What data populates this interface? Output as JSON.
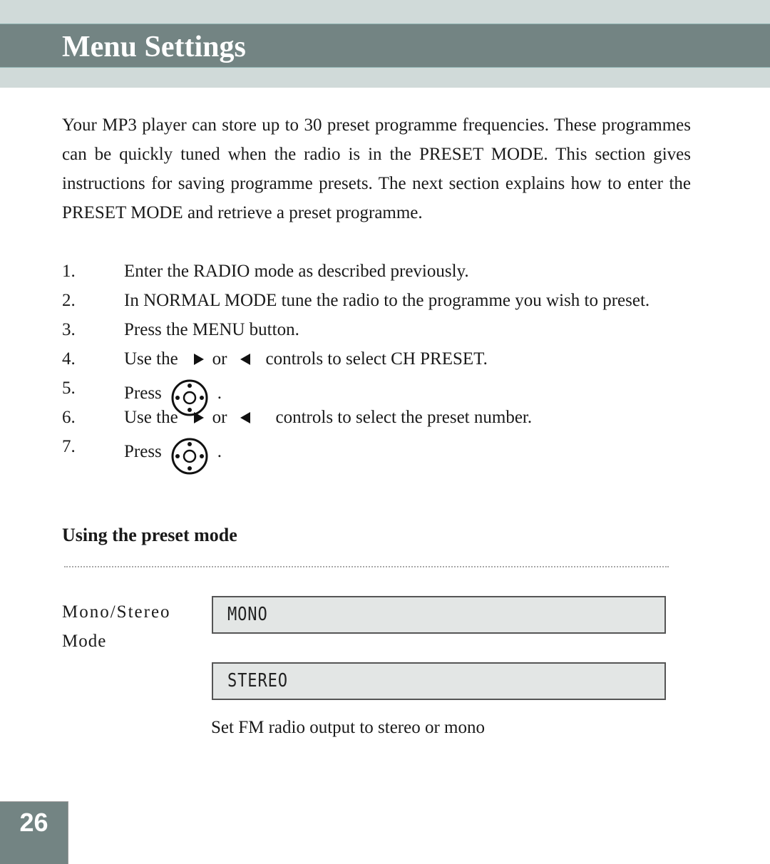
{
  "header": {
    "title": "Menu Settings"
  },
  "intro": "Your MP3 player can store up to 30 preset programme frequencies. These programmes can be quickly tuned when the radio is in the PRESET MODE. This section gives instructions for saving programme presets. The next section explains how to enter the PRESET MODE and retrieve a preset programme.",
  "steps": [
    {
      "num": "1.",
      "text": "Enter the RADIO mode as described previously."
    },
    {
      "num": "2.",
      "text": "In NORMAL MODE tune the radio to the programme you wish to preset."
    },
    {
      "num": "3.",
      "text": "Press the MENU button."
    },
    {
      "num": "4.",
      "pre": "Use the",
      "or": "or",
      "post": "controls to select CH PRESET.",
      "icons": [
        "right-arrow-icon",
        "left-arrow-icon"
      ]
    },
    {
      "num": "5.",
      "pre": "Press",
      "post": ".",
      "icons": [
        "joystick-button-icon"
      ]
    },
    {
      "num": "6.",
      "pre": "Use the",
      "or": "or",
      "post": "controls to select the preset number.",
      "icons": [
        "right-arrow-icon",
        "left-arrow-icon"
      ]
    },
    {
      "num": "7.",
      "pre": "Press",
      "post": ".",
      "icons": [
        "joystick-button-icon"
      ]
    }
  ],
  "section": {
    "title": "Using the preset mode",
    "label_line1": "Mono/Stereo",
    "label_line2": "Mode",
    "lcd_options": [
      "MONO",
      "STEREO"
    ],
    "caption": "Set FM radio output to stereo or mono"
  },
  "footer": {
    "page_number": "26"
  },
  "colors": {
    "header_band": "#738483",
    "light_band": "#d0dad9",
    "lcd_bg": "#e3e6e5"
  }
}
